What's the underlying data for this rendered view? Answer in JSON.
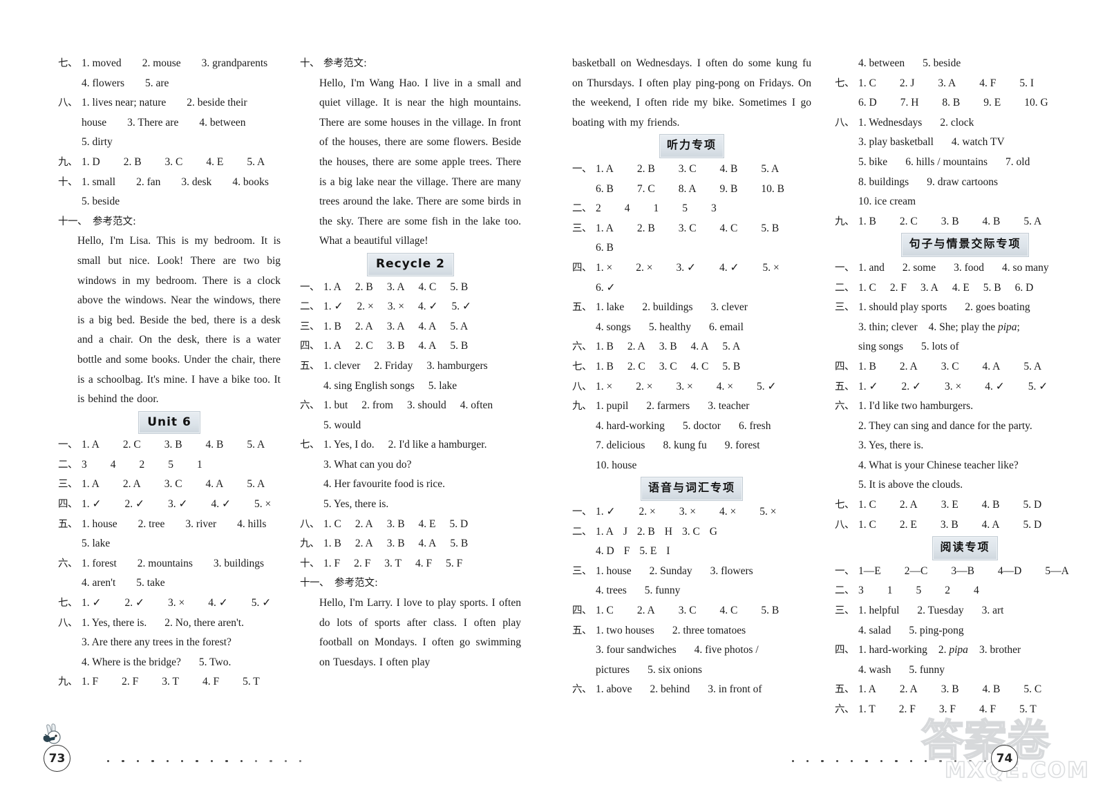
{
  "document": {
    "type": "answer-key-page",
    "page_numbers": {
      "left": "73",
      "right": "74"
    },
    "watermark": {
      "cn": "答案卷",
      "latin": "MXQE.COM"
    }
  },
  "headers": {
    "unit6": "Unit 6",
    "recycle2": "Recycle 2",
    "listening": "听力专项",
    "phonetics_vocab": "语音与词汇专项",
    "sentence_communication": "句子与情景交际专项",
    "reading": "阅读专项"
  },
  "labels": {
    "o1": "一、",
    "o2": "二、",
    "o3": "三、",
    "o4": "四、",
    "o5": "五、",
    "o6": "六、",
    "o7": "七、",
    "o8": "八、",
    "o9": "九、",
    "o10": "十、",
    "o11": "十一、",
    "model_essay": "参考范文:"
  },
  "column1": {
    "q7": {
      "line1": [
        "1. moved",
        "2. mouse",
        "3. grandparents"
      ],
      "line2": [
        "4. flowers",
        "5. are"
      ]
    },
    "q8": {
      "line1": [
        "1. lives near; nature",
        "2. beside their"
      ],
      "line2": [
        "house",
        "3. There are",
        "4. between"
      ],
      "line3": [
        "5. dirty"
      ]
    },
    "q9": {
      "line1": [
        "1. D",
        "2. B",
        "3. C",
        "4. E",
        "5. A"
      ]
    },
    "q10": {
      "line1": [
        "1. small",
        "2. fan",
        "3. desk",
        "4. books"
      ],
      "line2": [
        "5. beside"
      ]
    },
    "q11_essay": "Hello, I'm Lisa. This is my bedroom. It is small but nice. Look! There are two big windows in my bedroom. There is a clock above the windows. Near the windows, there is a big bed. Beside the bed, there is a desk and a chair. On the desk, there is a water bottle and some books. Under the chair, there is a schoolbag. It's mine. I have a bike too. It is behind the door.",
    "unit6": {
      "q1": [
        "1. A",
        "2. C",
        "3. B",
        "4. B",
        "5. A"
      ],
      "q2": [
        "3",
        "4",
        "2",
        "5",
        "1"
      ],
      "q3": [
        "1. A",
        "2. A",
        "3. C",
        "4. A",
        "5. A"
      ],
      "q4": [
        "1. ✓",
        "2. ✓",
        "3. ✓",
        "4. ✓",
        "5. ×"
      ],
      "q5_line1": [
        "1. house",
        "2. tree",
        "3. river",
        "4. hills"
      ],
      "q5_line2": [
        "5. lake"
      ],
      "q6_line1": [
        "1. forest",
        "2. mountains",
        "3. buildings"
      ],
      "q6_line2": [
        "4. aren't",
        "5. take"
      ],
      "q7": [
        "1. ✓",
        "2. ✓",
        "3. ×",
        "4. ✓",
        "5. ✓"
      ],
      "q8_line1": [
        "1. Yes, there is.",
        "2. No, there aren't."
      ],
      "q8_line2": "3. Are there any trees in the forest?",
      "q8_line3": [
        "4. Where is the bridge?",
        "5. Two."
      ],
      "q9": [
        "1. F",
        "2. F",
        "3. T",
        "4. F",
        "5. T"
      ]
    }
  },
  "column2": {
    "q10_essay": "Hello, I'm Wang Hao. I live in a small and quiet village. It is near the high mountains. There are some houses in the village. In front of the houses, there are some flowers. Beside the houses, there are some apple trees. There is a big lake near the village. There are many trees around the lake. There are some birds in the sky. There are some fish in the lake too. What a beautiful village!",
    "recycle2": {
      "q1": [
        "1. A",
        "2. B",
        "3. A",
        "4. C",
        "5. B"
      ],
      "q2": [
        "1. ✓",
        "2. ×",
        "3. ×",
        "4. ✓",
        "5. ✓"
      ],
      "q3": [
        "1. B",
        "2. A",
        "3. A",
        "4. A",
        "5. A"
      ],
      "q4": [
        "1. A",
        "2. C",
        "3. B",
        "4. A",
        "5. B"
      ],
      "q5_line1": [
        "1. clever",
        "2. Friday",
        "3. hamburgers"
      ],
      "q5_line2": [
        "4. sing English songs",
        "5. lake"
      ],
      "q6_line1": [
        "1. but",
        "2. from",
        "3. should",
        "4. often"
      ],
      "q6_line2": [
        "5. would"
      ],
      "q7_line1": [
        "1. Yes, I do.",
        "2. I'd like a hamburger."
      ],
      "q7_line2": "3. What can you do?",
      "q7_line3": "4. Her favourite food is rice.",
      "q7_line4": "5. Yes, there is.",
      "q8": [
        "1. C",
        "2. A",
        "3. B",
        "4. E",
        "5. D"
      ],
      "q9": [
        "1. B",
        "2. A",
        "3. B",
        "4. A",
        "5. B"
      ],
      "q10": [
        "1. F",
        "2. F",
        "3. T",
        "4. F",
        "5. F"
      ],
      "q11_essay_start": "Hello, I'm Larry. I love to play sports. I often do lots of sports after class. I often play football on Mondays. I often go swimming on Tuesdays. I often play"
    }
  },
  "column3": {
    "essay_continued": "basketball on Wednesdays. I often do some kung fu on Thursdays. I often play ping-pong on Fridays. On the weekend, I often ride my bike. Sometimes I go boating with my friends.",
    "listening": {
      "q1_line1": [
        "1. A",
        "2. B",
        "3. C",
        "4. B",
        "5. A"
      ],
      "q1_line2": [
        "6. B",
        "7. C",
        "8. A",
        "9. B",
        "10. B"
      ],
      "q2": [
        "2",
        "4",
        "1",
        "5",
        "3"
      ],
      "q3_line1": [
        "1. A",
        "2. B",
        "3. C",
        "4. C",
        "5. B"
      ],
      "q3_line2": [
        "6. B"
      ],
      "q4_line1": [
        "1. ×",
        "2. ×",
        "3. ✓",
        "4. ✓",
        "5. ×"
      ],
      "q4_line2": [
        "6. ✓"
      ],
      "q5_line1": [
        "1. lake",
        "2. buildings",
        "3. clever"
      ],
      "q5_line2": [
        "4. songs",
        "5. healthy",
        "6. email"
      ],
      "q6": [
        "1. B",
        "2. A",
        "3. B",
        "4. A",
        "5. A"
      ],
      "q7": [
        "1. B",
        "2. C",
        "3. C",
        "4. C",
        "5. B"
      ],
      "q8": [
        "1. ×",
        "2. ×",
        "3. ×",
        "4. ×",
        "5. ✓"
      ],
      "q9_line1": [
        "1. pupil",
        "2. farmers",
        "3. teacher"
      ],
      "q9_line2": [
        "4. hard-working",
        "5. doctor",
        "6. fresh"
      ],
      "q9_line3": [
        "7. delicious",
        "8. kung fu",
        "9. forest"
      ],
      "q9_line4": [
        "10. house"
      ]
    },
    "phonetics": {
      "q1": [
        "1. ✓",
        "2. ×",
        "3. ×",
        "4. ×",
        "5. ×"
      ],
      "q2_line1": [
        "1. A",
        "J",
        "2. B",
        "H",
        "3. C",
        "G"
      ],
      "q2_line2": [
        "4. D",
        "F",
        "5. E",
        "I"
      ],
      "q3_line1": [
        "1. house",
        "2. Sunday",
        "3. flowers"
      ],
      "q3_line2": [
        "4. trees",
        "5. funny"
      ],
      "q4": [
        "1. C",
        "2. A",
        "3. C",
        "4. C",
        "5. B"
      ],
      "q5_line1": [
        "1. two houses",
        "2. three tomatoes"
      ],
      "q5_line2": [
        "3. four sandwiches",
        "4. five photos /"
      ],
      "q5_line3": [
        "pictures",
        "5. six onions"
      ],
      "q6_line1": [
        "1. above",
        "2. behind",
        "3. in front of"
      ]
    }
  },
  "column4": {
    "phonetics_cont": {
      "q6_line2": [
        "4. between",
        "5. beside"
      ],
      "q7_line1": [
        "1. C",
        "2. J",
        "3. A",
        "4. F",
        "5. I"
      ],
      "q7_line2": [
        "6. D",
        "7. H",
        "8. B",
        "9. E",
        "10. G"
      ],
      "q8_line1": [
        "1. Wednesdays",
        "2. clock"
      ],
      "q8_line2": [
        "3. play basketball",
        "4. watch TV"
      ],
      "q8_line3": [
        "5. bike",
        "6. hills / mountains",
        "7. old"
      ],
      "q8_line4": [
        "8. buildings",
        "9. draw cartoons"
      ],
      "q8_line5": [
        "10. ice cream"
      ],
      "q9": [
        "1. B",
        "2. C",
        "3. B",
        "4. B",
        "5. A"
      ]
    },
    "sentence_comm": {
      "q1": [
        "1. and",
        "2. some",
        "3. food",
        "4. so many"
      ],
      "q2": [
        "1. C",
        "2. F",
        "3. A",
        "4. E",
        "5. B",
        "6. D"
      ],
      "q3_line1": [
        "1. should play sports",
        "2. goes boating"
      ],
      "q3_line2_a": "3. thin; clever",
      "q3_line2_b": "4. She; play the ",
      "q3_line2_italic": "pipa",
      "q3_line2_c": ";",
      "q3_line3": [
        "sing songs",
        "5. lots of"
      ],
      "q4": [
        "1. B",
        "2. A",
        "3. C",
        "4. A",
        "5. A"
      ],
      "q5": [
        "1. ✓",
        "2. ✓",
        "3. ×",
        "4. ✓",
        "5. ✓"
      ],
      "q6_line1": "1. I'd like two hamburgers.",
      "q6_line2": "2. They can sing and dance for the party.",
      "q6_line3": "3. Yes, there is.",
      "q6_line4": "4. What is your Chinese teacher like?",
      "q6_line5": "5. It is above the clouds.",
      "q7": [
        "1. C",
        "2. A",
        "3. E",
        "4. B",
        "5. D"
      ],
      "q8": [
        "1. C",
        "2. E",
        "3. B",
        "4. A",
        "5. D"
      ]
    },
    "reading": {
      "q1": [
        "1—E",
        "2—C",
        "3—B",
        "4—D",
        "5—A"
      ],
      "q2": [
        "3",
        "1",
        "5",
        "2",
        "4"
      ],
      "q3_line1": [
        "1. helpful",
        "2. Tuesday",
        "3. art"
      ],
      "q3_line2": [
        "4. salad",
        "5. ping-pong"
      ],
      "q4_line1_a": "1. hard-working",
      "q4_line1_italic": "pipa",
      "q4_line1_b": "2. ",
      "q4_line1_c": "3. brother",
      "q4_line2": [
        "4. wash",
        "5. funny"
      ],
      "q5": [
        "1. A",
        "2. A",
        "3. B",
        "4. B",
        "5. C"
      ],
      "q6": [
        "1. T",
        "2. F",
        "3. F",
        "4. F",
        "5. T"
      ]
    }
  }
}
